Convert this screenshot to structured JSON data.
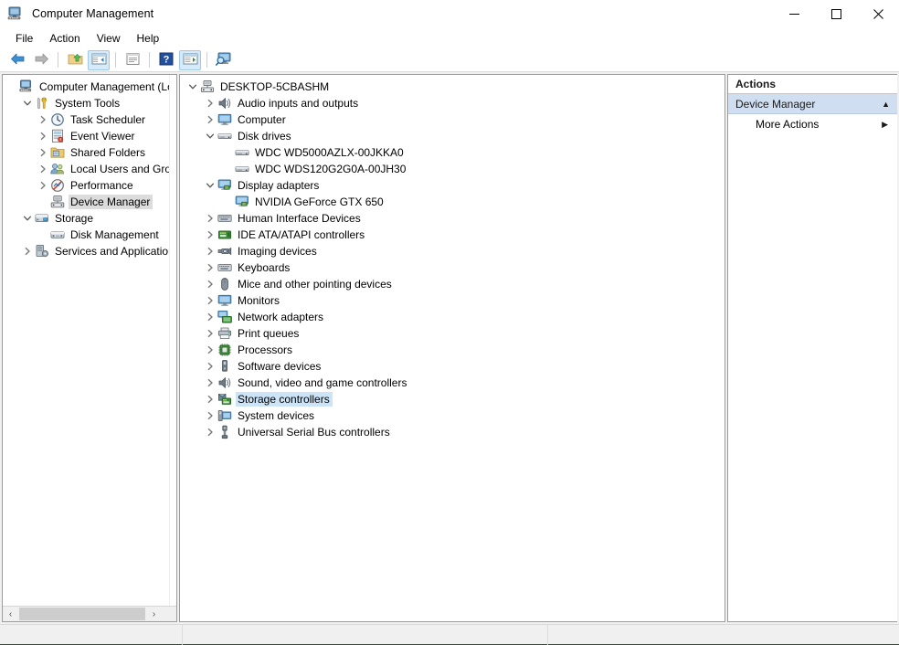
{
  "window": {
    "title": "Computer Management",
    "icon": "computer-management-icon",
    "caption_buttons": [
      {
        "name": "minimize-button",
        "glyph": "─"
      },
      {
        "name": "maximize-button",
        "glyph": "□"
      },
      {
        "name": "close-button",
        "glyph": "✕"
      }
    ]
  },
  "menubar": {
    "items": [
      {
        "label": "File",
        "name": "menu-file"
      },
      {
        "label": "Action",
        "name": "menu-action"
      },
      {
        "label": "View",
        "name": "menu-view"
      },
      {
        "label": "Help",
        "name": "menu-help"
      }
    ]
  },
  "toolbar": {
    "buttons": [
      {
        "name": "back-button",
        "icon": "back-arrow-icon",
        "active": false
      },
      {
        "name": "forward-button",
        "icon": "forward-arrow-icon",
        "active": false
      },
      {
        "name": "up-one-level-button",
        "icon": "folder-up-icon",
        "active": false
      },
      {
        "name": "show-hide-console-tree-button",
        "icon": "console-tree-icon",
        "active": true
      },
      {
        "name": "properties-button",
        "icon": "properties-icon",
        "active": false
      },
      {
        "name": "help-button",
        "icon": "help-question-icon",
        "active": false
      },
      {
        "name": "show-hide-action-pane-button",
        "icon": "action-pane-icon",
        "active": true
      },
      {
        "name": "scan-hardware-changes-button",
        "icon": "monitor-search-icon",
        "active": false
      }
    ]
  },
  "console_tree": {
    "items": [
      {
        "label": "Computer Management (Local",
        "icon": "computer-management-icon",
        "indent": 0,
        "twisty": "",
        "selected": "none"
      },
      {
        "label": "System Tools",
        "icon": "system-tools-icon",
        "indent": 1,
        "twisty": "expanded",
        "selected": "none"
      },
      {
        "label": "Task Scheduler",
        "icon": "clock-icon",
        "indent": 2,
        "twisty": "collapsed",
        "selected": "none"
      },
      {
        "label": "Event Viewer",
        "icon": "event-viewer-icon",
        "indent": 2,
        "twisty": "collapsed",
        "selected": "none"
      },
      {
        "label": "Shared Folders",
        "icon": "shared-folders-icon",
        "indent": 2,
        "twisty": "collapsed",
        "selected": "none"
      },
      {
        "label": "Local Users and Groups",
        "icon": "users-groups-icon",
        "indent": 2,
        "twisty": "collapsed",
        "selected": "none"
      },
      {
        "label": "Performance",
        "icon": "performance-icon",
        "indent": 2,
        "twisty": "collapsed",
        "selected": "none"
      },
      {
        "label": "Device Manager",
        "icon": "device-manager-icon",
        "indent": 2,
        "twisty": "",
        "selected": "inactive"
      },
      {
        "label": "Storage",
        "icon": "storage-icon",
        "indent": 1,
        "twisty": "expanded",
        "selected": "none"
      },
      {
        "label": "Disk Management",
        "icon": "disk-management-icon",
        "indent": 2,
        "twisty": "",
        "selected": "none"
      },
      {
        "label": "Services and Applications",
        "icon": "services-applications-icon",
        "indent": 1,
        "twisty": "collapsed",
        "selected": "none"
      }
    ],
    "hscroll": {
      "left_arrow": "‹",
      "right_arrow": "›"
    }
  },
  "device_tree": {
    "items": [
      {
        "label": "DESKTOP-5CBASHM",
        "icon": "computer-root-icon",
        "indent": 0,
        "twisty": "expanded",
        "selected": "none"
      },
      {
        "label": "Audio inputs and outputs",
        "icon": "speaker-icon",
        "indent": 1,
        "twisty": "collapsed",
        "selected": "none"
      },
      {
        "label": "Computer",
        "icon": "monitor-icon",
        "indent": 1,
        "twisty": "collapsed",
        "selected": "none"
      },
      {
        "label": "Disk drives",
        "icon": "disk-drive-icon",
        "indent": 1,
        "twisty": "expanded",
        "selected": "none"
      },
      {
        "label": "WDC WD5000AZLX-00JKKA0",
        "icon": "disk-drive-icon",
        "indent": 2,
        "twisty": "",
        "selected": "none"
      },
      {
        "label": "WDC WDS120G2G0A-00JH30",
        "icon": "disk-drive-icon",
        "indent": 2,
        "twisty": "",
        "selected": "none"
      },
      {
        "label": "Display adapters",
        "icon": "display-adapter-icon",
        "indent": 1,
        "twisty": "expanded",
        "selected": "none"
      },
      {
        "label": "NVIDIA GeForce GTX 650",
        "icon": "display-adapter-icon",
        "indent": 2,
        "twisty": "",
        "selected": "none"
      },
      {
        "label": "Human Interface Devices",
        "icon": "hid-icon",
        "indent": 1,
        "twisty": "collapsed",
        "selected": "none"
      },
      {
        "label": "IDE ATA/ATAPI controllers",
        "icon": "ide-controller-icon",
        "indent": 1,
        "twisty": "collapsed",
        "selected": "none"
      },
      {
        "label": "Imaging devices",
        "icon": "camera-icon",
        "indent": 1,
        "twisty": "collapsed",
        "selected": "none"
      },
      {
        "label": "Keyboards",
        "icon": "keyboard-icon",
        "indent": 1,
        "twisty": "collapsed",
        "selected": "none"
      },
      {
        "label": "Mice and other pointing devices",
        "icon": "mouse-icon",
        "indent": 1,
        "twisty": "collapsed",
        "selected": "none"
      },
      {
        "label": "Monitors",
        "icon": "monitor-icon",
        "indent": 1,
        "twisty": "collapsed",
        "selected": "none"
      },
      {
        "label": "Network adapters",
        "icon": "network-adapter-icon",
        "indent": 1,
        "twisty": "collapsed",
        "selected": "none"
      },
      {
        "label": "Print queues",
        "icon": "printer-icon",
        "indent": 1,
        "twisty": "collapsed",
        "selected": "none"
      },
      {
        "label": "Processors",
        "icon": "processor-icon",
        "indent": 1,
        "twisty": "collapsed",
        "selected": "none"
      },
      {
        "label": "Software devices",
        "icon": "software-device-icon",
        "indent": 1,
        "twisty": "collapsed",
        "selected": "none"
      },
      {
        "label": "Sound, video and game controllers",
        "icon": "speaker-icon",
        "indent": 1,
        "twisty": "collapsed",
        "selected": "none"
      },
      {
        "label": "Storage controllers",
        "icon": "storage-controller-icon",
        "indent": 1,
        "twisty": "collapsed",
        "selected": "active"
      },
      {
        "label": "System devices",
        "icon": "system-device-icon",
        "indent": 1,
        "twisty": "collapsed",
        "selected": "none"
      },
      {
        "label": "Universal Serial Bus controllers",
        "icon": "usb-icon",
        "indent": 1,
        "twisty": "collapsed",
        "selected": "none"
      }
    ]
  },
  "actions_pane": {
    "header": "Actions",
    "groups": [
      {
        "label": "Device Manager",
        "name": "actions-group-device-manager",
        "collapse_glyph": "▲",
        "items": [
          {
            "label": "More Actions",
            "name": "action-more-actions",
            "submenu_glyph": "▶"
          }
        ]
      }
    ]
  },
  "statusbar": {
    "panes": [
      "",
      "",
      ""
    ]
  },
  "colors": {
    "selection_active": "#cce4f7",
    "selection_inactive": "#dcdcdc",
    "actions_group_bg": "#cfdef0",
    "toolbar_active_bg": "#d6eaf8",
    "window_bg": "#ffffff",
    "chrome_bg": "#f0f0f0"
  }
}
